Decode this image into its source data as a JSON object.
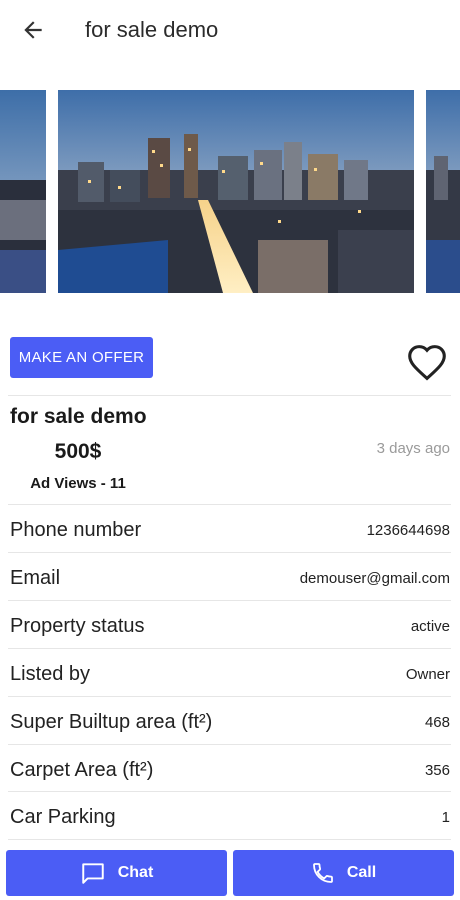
{
  "header": {
    "title": "for sale demo",
    "back_icon": "arrow-left-icon"
  },
  "ad": {
    "offer_label": "MAKE AN OFFER",
    "title": "for sale demo",
    "price": "500$",
    "posted": "3 days ago",
    "views": "Ad Views - 11"
  },
  "details": [
    {
      "label": "Phone number",
      "value": "1236644698"
    },
    {
      "label": "Email",
      "value": "demouser@gmail.com"
    },
    {
      "label": "Property status",
      "value": "active"
    },
    {
      "label": "Listed by",
      "value": "Owner"
    },
    {
      "label": "Super Builtup area (ft²)",
      "value": "468"
    },
    {
      "label": "Carpet Area (ft²)",
      "value": "356"
    },
    {
      "label": "Car Parking",
      "value": "1"
    }
  ],
  "actions": {
    "chat_label": "Chat",
    "call_label": "Call"
  },
  "colors": {
    "accent": "#4b5df5"
  }
}
